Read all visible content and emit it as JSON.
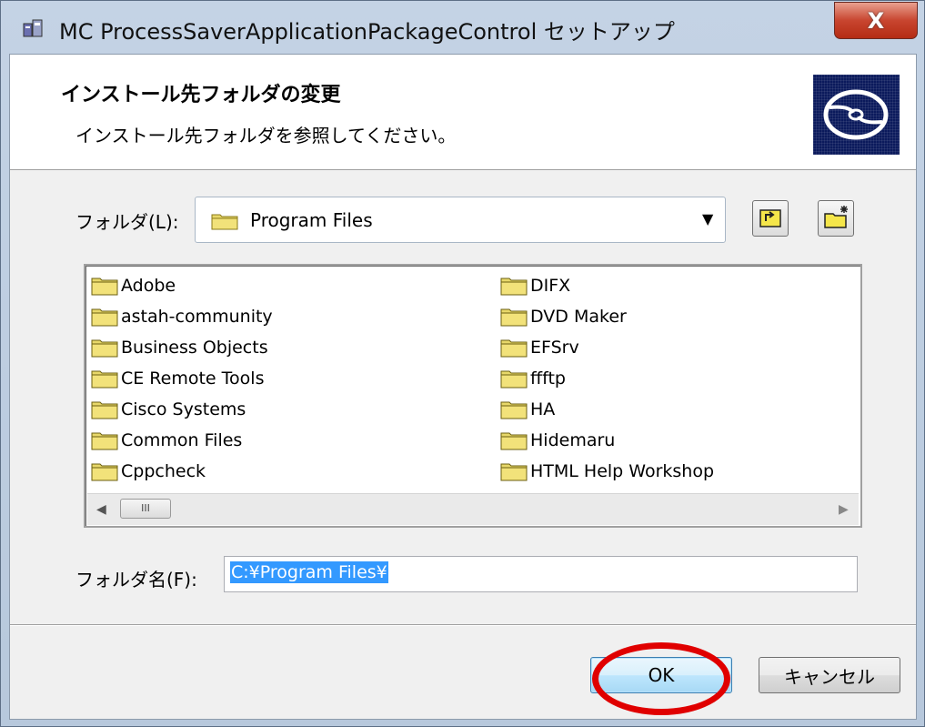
{
  "window": {
    "title": "MC ProcessSaverApplicationPackageControl セットアップ",
    "close_label": "X"
  },
  "header": {
    "title": "インストール先フォルダの変更",
    "subtitle": "インストール先フォルダを参照してください。",
    "logo_icon": "cd-disc-icon"
  },
  "folder_combo": {
    "label": "フォルダ(L):",
    "value": "Program Files",
    "arrow": "▼"
  },
  "folder_list": {
    "left_column": [
      "Adobe",
      "astah-community",
      "Business Objects",
      "CE Remote Tools",
      "Cisco Systems",
      "Common Files",
      "Cppcheck"
    ],
    "right_column": [
      "DIFX",
      "DVD Maker",
      "EFSrv",
      "ffftp",
      "HA",
      "Hidemaru",
      "HTML Help Workshop"
    ]
  },
  "scrollbar": {
    "left_arrow": "◀",
    "right_arrow": "▶",
    "thumb_grip": "III"
  },
  "folder_name": {
    "label": "フォルダ名(F):",
    "value": "C:¥Program Files¥"
  },
  "buttons": {
    "ok": "OK",
    "cancel": "キャンセル"
  },
  "colors": {
    "annotation": "#e00000",
    "selection": "#3399ff"
  }
}
